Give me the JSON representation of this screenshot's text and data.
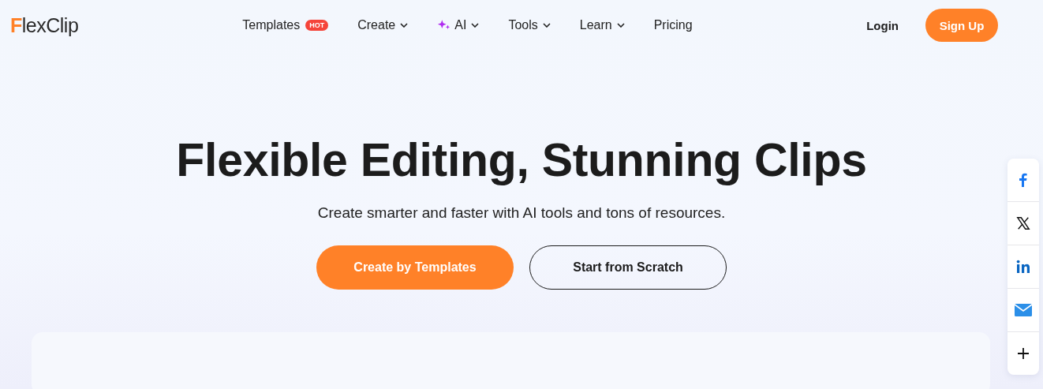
{
  "logo": "FlexClip",
  "nav": [
    {
      "label": "Templates",
      "badge": "HOT",
      "dropdown": false,
      "kind": "plain"
    },
    {
      "label": "Create",
      "dropdown": true,
      "kind": "plain"
    },
    {
      "label": "AI",
      "dropdown": true,
      "kind": "ai"
    },
    {
      "label": "Tools",
      "dropdown": true,
      "kind": "plain"
    },
    {
      "label": "Learn",
      "dropdown": true,
      "kind": "plain"
    },
    {
      "label": "Pricing",
      "dropdown": false,
      "kind": "plain"
    }
  ],
  "login": "Login",
  "signup": "Sign Up",
  "hero": {
    "title": "Flexible Editing, Stunning Clips",
    "subtitle": "Create smarter and faster with AI tools and tons of resources.",
    "buttons": [
      {
        "label": "Create by Templates",
        "kind": "primary"
      },
      {
        "label": "Start from Scratch",
        "kind": "outline"
      }
    ]
  },
  "share": [
    {
      "kind": "facebook"
    },
    {
      "kind": "x"
    },
    {
      "kind": "linkedin"
    },
    {
      "kind": "email"
    },
    {
      "kind": "more"
    }
  ]
}
